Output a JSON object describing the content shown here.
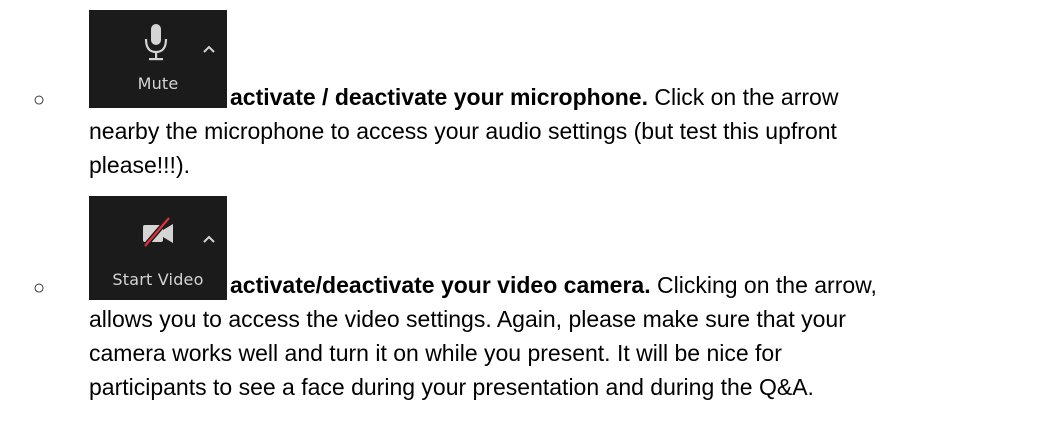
{
  "items": [
    {
      "button": {
        "label": "Mute",
        "icon": "microphone-icon"
      },
      "bold_text": "activate / deactivate your microphone.",
      "line1_rest": " Click on the arrow",
      "line2": "nearby the microphone to access your audio settings (but test this upfront",
      "line3": "please!!!)."
    },
    {
      "button": {
        "label": "Start Video",
        "icon": "video-camera-off-icon"
      },
      "bold_text": "activate/deactivate your video camera.",
      "line1_rest": " Clicking on the arrow,",
      "line2": "allows you to access the video settings. Again, please make sure that your",
      "line3": "camera works well and turn it on while you present. It will be nice for",
      "line4": "participants to see a face during your presentation and during the Q&A."
    }
  ],
  "colors": {
    "button_bg": "#1b1b1b",
    "icon": "#d4d4d4",
    "slash": "#e0303a"
  }
}
